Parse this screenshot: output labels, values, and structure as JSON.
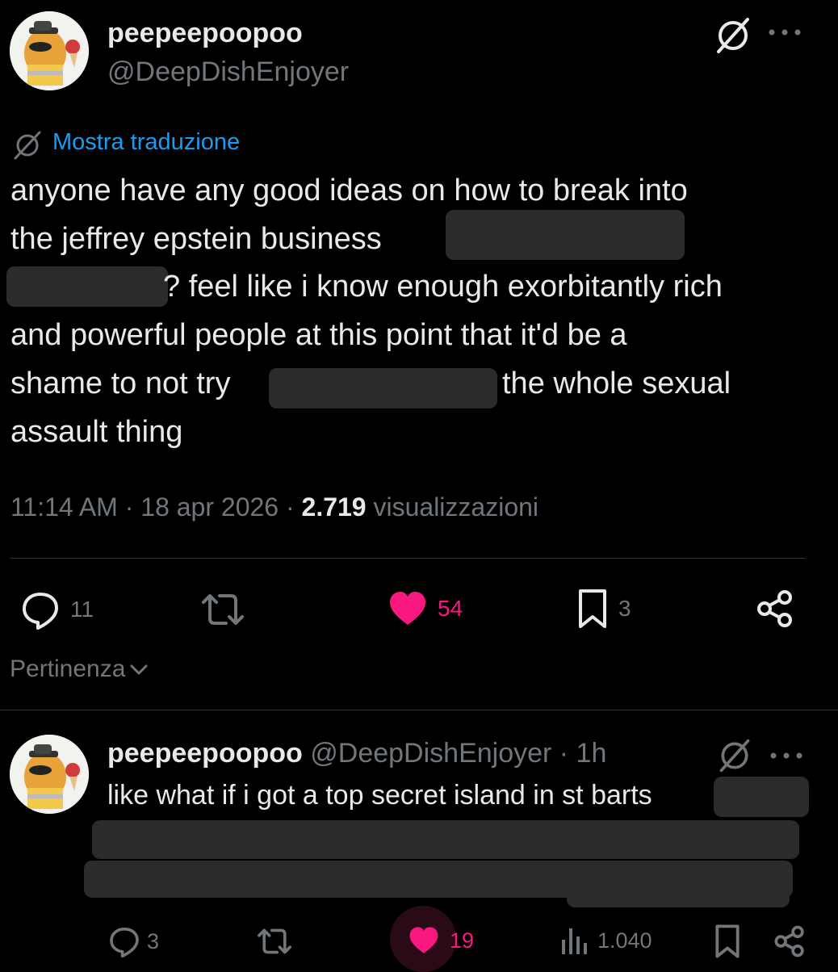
{
  "main_tweet": {
    "author": {
      "display_name": "peepeepoopoo",
      "handle": "@DeepDishEnjoyer"
    },
    "translate_label": "Mostra traduzione",
    "text_lines": [
      "anyone have any good ideas on how to break into",
      "the jeffrey epstein business",
      "? feel like i know enough exorbitantly rich",
      "and powerful people at this point that it'd be a",
      "shame to not try",
      "the whole sexual",
      "assault thing"
    ],
    "meta": {
      "time": "11:14 AM",
      "sep1": " · ",
      "date": "18 apr 2026",
      "sep2": " · ",
      "views_count": "2.719",
      "views_label": " visualizzazioni"
    },
    "actions": {
      "replies": "11",
      "likes": "54",
      "bookmarks": "3"
    },
    "sort_label": "Pertinenza"
  },
  "reply": {
    "author": {
      "display_name": "peepeepoopoo",
      "handle": "@DeepDishEnjoyer",
      "time": " · 1h"
    },
    "text_line": "like what if i got a top secret island in st barts",
    "actions": {
      "replies": "3",
      "likes": "19",
      "views": "1.040"
    }
  },
  "colors": {
    "background": "#000000",
    "text": "#e7e9ea",
    "muted": "#71767b",
    "link": "#1d9bf0",
    "like": "#f91880",
    "redaction": "#2b2b2b"
  },
  "icons": [
    "grok-icon",
    "more-icon",
    "translate-icon",
    "reply-icon",
    "retweet-icon",
    "heart-icon",
    "bookmark-icon",
    "share-icon",
    "views-icon",
    "chevron-down-icon"
  ]
}
